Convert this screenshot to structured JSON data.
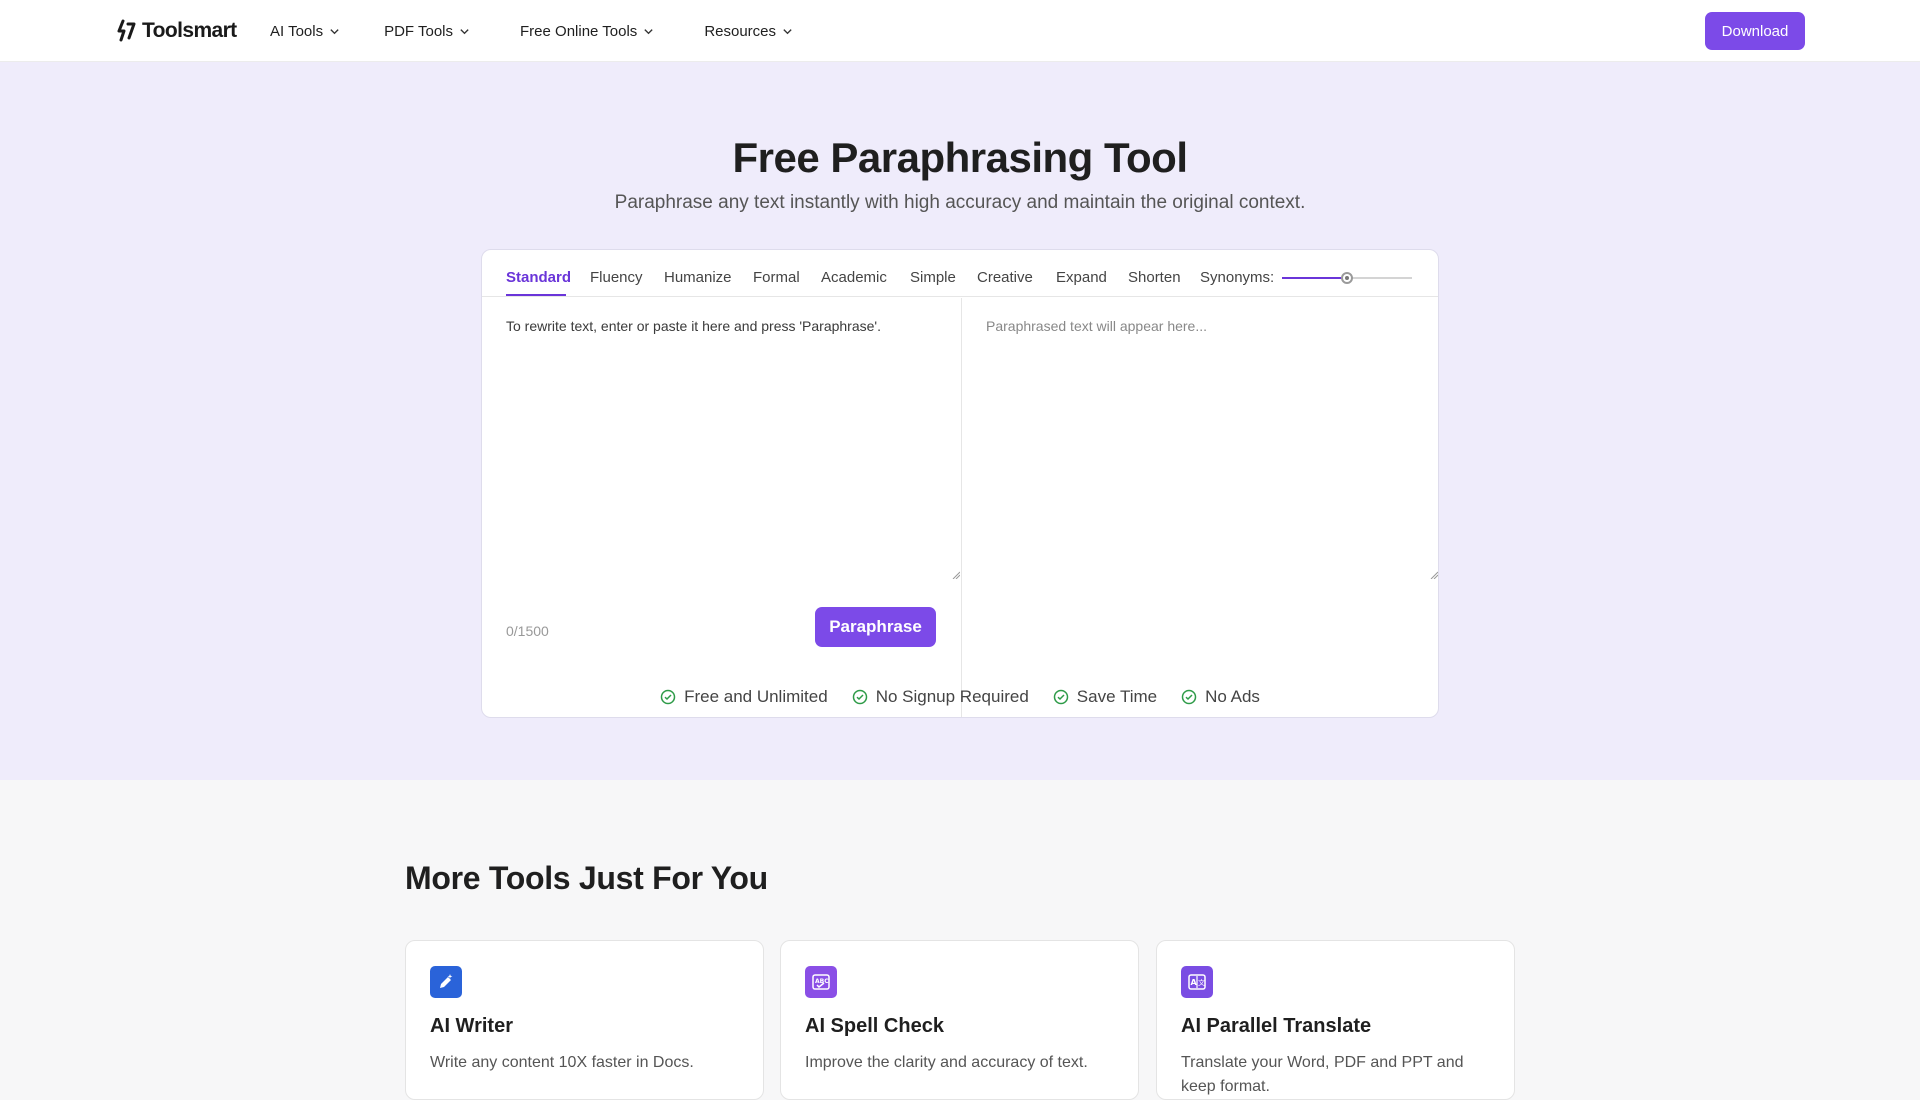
{
  "header": {
    "logo_text": "Toolsmart",
    "nav": [
      {
        "label": "AI Tools"
      },
      {
        "label": "PDF Tools"
      },
      {
        "label": "Free Online Tools"
      },
      {
        "label": "Resources"
      }
    ],
    "download_label": "Download"
  },
  "hero": {
    "title": "Free Paraphrasing Tool",
    "subtitle": "Paraphrase any text instantly with high accuracy and maintain the original context."
  },
  "tool": {
    "tabs": [
      "Standard",
      "Fluency",
      "Humanize",
      "Formal",
      "Academic",
      "Simple",
      "Creative",
      "Expand",
      "Shorten"
    ],
    "active_tab": "Standard",
    "synonyms_label": "Synonyms:",
    "synonyms_level": 0.5,
    "input_placeholder": "To rewrite text, enter or paste it here and press 'Paraphrase'.",
    "output_placeholder": "Paraphrased text will appear here...",
    "char_count": "0/1500",
    "paraphrase_label": "Paraphrase"
  },
  "features": [
    "Free and Unlimited",
    "No Signup Required",
    "Save Time",
    "No Ads"
  ],
  "more_tools": {
    "title": "More Tools Just For You",
    "items": [
      {
        "name": "AI Writer",
        "desc": "Write any content 10X faster in Docs.",
        "icon": "pen-sparkle-icon",
        "color": "#2a63d9"
      },
      {
        "name": "AI Spell Check",
        "desc": "Improve the clarity and accuracy of text.",
        "icon": "spell-check-icon",
        "color": "#8a4fe6"
      },
      {
        "name": "AI Parallel Translate",
        "desc": "Translate your Word, PDF and PPT and keep format.",
        "icon": "translate-icon",
        "color": "#7a4de3"
      }
    ]
  },
  "colors": {
    "accent": "#7c4ae8",
    "active_tab": "#6a35d9",
    "hero_bg": "#efecfb",
    "check_green": "#2e9b48"
  }
}
